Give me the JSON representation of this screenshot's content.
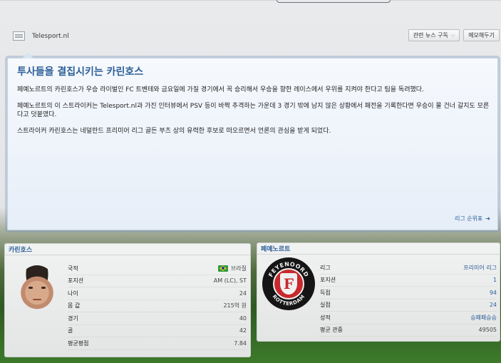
{
  "source": {
    "name": "Telesport.nl",
    "icon": "newspaper-icon"
  },
  "actions": {
    "subscribe_label": "관련 뉴스 구독",
    "memo_label": "메모해두기"
  },
  "news": {
    "title": "투사들을 결집시키는 카린호스",
    "paragraphs": [
      "페예노르트의 카린호스가 우승 라이벌인 FC 트벤테와 금요일에 가질 경기에서 꼭 승리해서 우승을 향한 레이스에서 우위를 지켜야 한다고 팀을 독려했다.",
      "페예노르트의 이 스트라이커는 Telesport.nl과 가진 인터뷰에서 PSV 등이 바짝 추격하는 가운데 3 경기 밖에 남지 않은 상황에서 패전을 기록한다면 우승이 물 건너 갈지도 모른다고 덧붙였다.",
      "스트라이커 카린호스는 네덜란드 프리미어 리그 골든 부츠 상의 유력한 후보로 떠오르면서 언론의 관심을 받게 되었다."
    ],
    "link_label": "리그 순위표"
  },
  "player": {
    "name": "카린호스",
    "rows": [
      {
        "label": "국적",
        "value": "브라질"
      },
      {
        "label": "포지션",
        "value": "AM (LC), ST"
      },
      {
        "label": "나이",
        "value": "24"
      },
      {
        "label": "몸 값",
        "value": "215억 원"
      },
      {
        "label": "경기",
        "value": "40"
      },
      {
        "label": "골",
        "value": "42"
      },
      {
        "label": "평균평점",
        "value": "7.84"
      }
    ],
    "flag_colors": {
      "green": "#2f9a3b",
      "yellow": "#f3d32b",
      "blue": "#1d3f8f"
    }
  },
  "club": {
    "name": "페예노르트",
    "rows": [
      {
        "label": "리그",
        "value": "프리미어 리그"
      },
      {
        "label": "포지션",
        "value": "1"
      },
      {
        "label": "득점",
        "value": "94"
      },
      {
        "label": "실점",
        "value": "24"
      },
      {
        "label": "성적",
        "value": "승패패승승"
      },
      {
        "label": "평균 관중",
        "value": "49505"
      }
    ],
    "crest_text_top": "FEYENOORD",
    "crest_text_bottom": "ROTTERDAM",
    "crest_letter": "F"
  },
  "colors": {
    "accent": "#2c5f99",
    "panel_border": "#c6d3e2"
  }
}
